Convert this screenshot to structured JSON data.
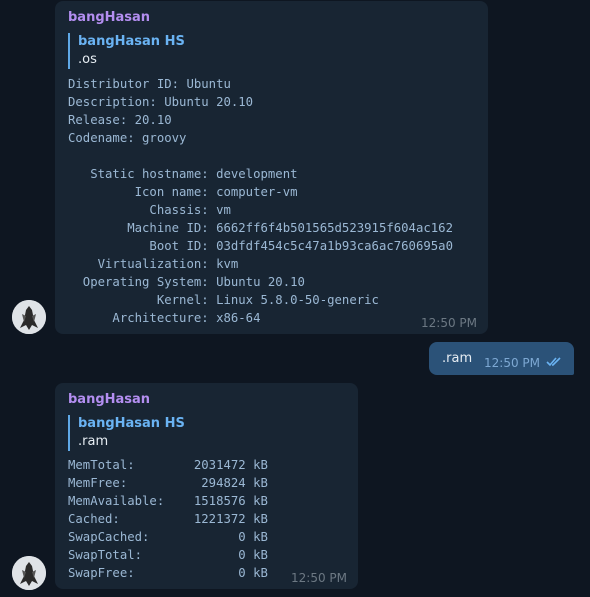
{
  "messages": [
    {
      "sender": "bangHasan",
      "reply_to": {
        "name": "bangHasan HS",
        "text": ".os"
      },
      "lines": [
        "Distributor ID: Ubuntu",
        "Description: Ubuntu 20.10",
        "Release: 20.10",
        "Codename: groovy",
        "",
        "   Static hostname: development",
        "         Icon name: computer-vm",
        "           Chassis: vm",
        "        Machine ID: 6662ff6f4b501565d523915f604ac162",
        "           Boot ID: 03dfdf454c5c47a1b93ca6ac760695a0",
        "    Virtualization: kvm",
        "  Operating System: Ubuntu 20.10",
        "            Kernel: Linux 5.8.0-50-generic",
        "      Architecture: x86-64"
      ],
      "time": "12:50 PM"
    },
    {
      "outgoing": true,
      "text": ".ram",
      "time": "12:50 PM",
      "status_icon": "double-check-icon"
    },
    {
      "sender": "bangHasan",
      "reply_to": {
        "name": "bangHasan HS",
        "text": ".ram"
      },
      "lines": [
        "MemTotal:        2031472 kB",
        "MemFree:          294824 kB",
        "MemAvailable:    1518576 kB",
        "Cached:          1221372 kB",
        "SwapCached:            0 kB",
        "SwapTotal:             0 kB",
        "SwapFree:              0 kB"
      ],
      "time": "12:50 PM"
    }
  ],
  "colors": {
    "background": "#0e1621",
    "incoming_bubble": "#182533",
    "outgoing_bubble": "#2b5278",
    "sender_name": "#b38ef0",
    "reply_accent": "#6ab3f3",
    "mono_text": "#9bb8d4"
  }
}
